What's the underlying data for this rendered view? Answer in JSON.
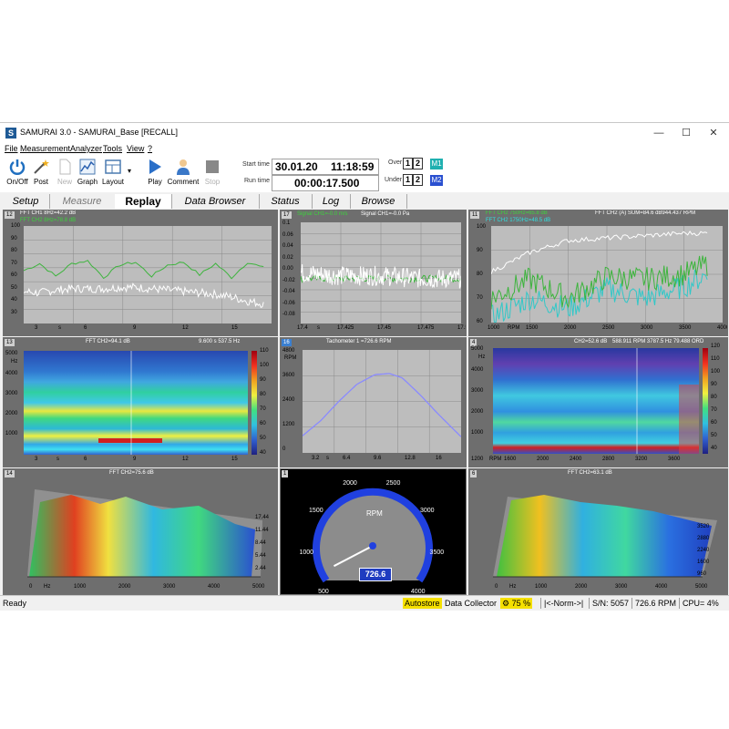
{
  "window": {
    "title": "SAMURAI 3.0 - SAMURAI_Base [RECALL]",
    "logo": "S"
  },
  "menu": [
    "File",
    "Measurement",
    "Analyzer",
    "Tools",
    "View",
    "?"
  ],
  "toolbar": {
    "onoff": "On/Off",
    "post": "Post",
    "new": "New",
    "graph": "Graph",
    "layout": "Layout",
    "play": "Play",
    "comment": "Comment",
    "stop": "Stop",
    "start_time_label": "Start time",
    "start_date": "30.01.20",
    "start_clock": "11:18:59",
    "run_time_label": "Run time",
    "run_time": "00:00:17.500",
    "over_label": "Over",
    "under_label": "Under",
    "one": "1",
    "two": "2",
    "m1": "M1",
    "m2": "M2"
  },
  "tabs": [
    "Setup",
    "Measure",
    "Replay",
    "Data Browser",
    "Status",
    "Log",
    "Browse"
  ],
  "panels": {
    "p12": {
      "num": "12",
      "line1": "FFT CH1 8Hz=42.2 dB",
      "line2": "FFT CH2 8Hz=78.8 dB",
      "y": [
        "100",
        "90",
        "80",
        "70",
        "60",
        "50",
        "40",
        "30"
      ],
      "ylab": "dB\nRMS",
      "x": [
        "3",
        "6",
        "9",
        "12",
        "15"
      ],
      "xunit": "s"
    },
    "p17": {
      "num": "17",
      "line1": "Signal CH1=-0.0 m/s",
      "line2": "Signal CH1=-0.0 Pa",
      "y": [
        "0.1",
        "0.06",
        "0.04",
        "0.02",
        "0.00",
        "-0.02",
        "-0.04",
        "-0.06",
        "-0.08"
      ],
      "yunit": "m/s2",
      "x": [
        "17.4",
        "17.425",
        "17.45",
        "17.475",
        "17.5"
      ],
      "xunit": "s"
    },
    "p11": {
      "num": "11",
      "line1": "FFT CH2 750Hz=65.8 dB",
      "line2": "FFT CH2 1750Hz=48.5 dB",
      "right": "FFT CH2 (A) SUM=84.6 dB944.437 RPM",
      "y": [
        "100",
        "90",
        "80",
        "70",
        "60"
      ],
      "yunit": "dB\nRMS",
      "x": [
        "1000",
        "1500",
        "2000",
        "2500",
        "3000",
        "3500",
        "4000"
      ],
      "xunit": "RPM"
    },
    "p13": {
      "num": "13",
      "title": "FFT CH2=94.1 dB",
      "right": "9.600 s   537.5 Hz",
      "y": [
        "5000",
        "4000",
        "3000",
        "2000",
        "1000"
      ],
      "yunit": "Hz",
      "x": [
        "3",
        "6",
        "9",
        "12",
        "15"
      ],
      "xunit": "s",
      "scale": [
        "110",
        "100",
        "90",
        "80",
        "70",
        "60",
        "50",
        "40"
      ],
      "sunit": "dB\nRMS"
    },
    "p16": {
      "num": "16",
      "title": "Tachometer 1 =726.6 RPM",
      "y": [
        "4800",
        "3600",
        "2400",
        "1200",
        "0"
      ],
      "yunit": "RPM",
      "x": [
        "3.2",
        "6.4",
        "9.6",
        "12.8",
        "16"
      ],
      "xunit": "s"
    },
    "p4": {
      "num": "4",
      "title": "CH2=52.6 dB",
      "right": "588.911 RPM   3787.5 Hz 79.488 ORD",
      "y": [
        "5000",
        "4000",
        "3000",
        "2000",
        "1000"
      ],
      "yunit": "Hz",
      "x": [
        "1200",
        "1600",
        "2000",
        "2400",
        "2800",
        "3200",
        "3600"
      ],
      "xunit": "RPM",
      "scale": [
        "120",
        "110",
        "100",
        "90",
        "80",
        "70",
        "60",
        "50",
        "40"
      ],
      "sunit": "dB"
    },
    "p14": {
      "num": "14",
      "title": "FFT CH2=75.6 dB",
      "x": [
        "0",
        "1000",
        "2000",
        "3000",
        "4000",
        "5000"
      ],
      "xunit": "Hz",
      "z": [
        "17.44",
        "11.44",
        "8.44",
        "5.44",
        "2.44"
      ]
    },
    "p1": {
      "num": "1",
      "unit": "RPM",
      "value": "726.6",
      "ticks": [
        "500",
        "1000",
        "1500",
        "2000",
        "2500",
        "3000",
        "3500",
        "4000"
      ]
    },
    "p6": {
      "num": "6",
      "title": "FFT CH2=63.1 dB",
      "x": [
        "0",
        "1000",
        "2000",
        "3000",
        "4000",
        "5000"
      ],
      "xunit": "Hz",
      "z": [
        "3520",
        "2880",
        "2240",
        "1600",
        "960"
      ]
    }
  },
  "chart_data": [
    {
      "type": "line",
      "title": "FFT CH1 8Hz=42.2 dB",
      "ylabel": "dB RMS",
      "xlabel": "s",
      "ylim": [
        30,
        100
      ],
      "xlim": [
        2,
        17.5
      ],
      "series": [
        {
          "name": "FFT CH1 8Hz=42.2 dB",
          "color": "#ffffff",
          "x": [
            2,
            3,
            4,
            5,
            6,
            7,
            8,
            9,
            10,
            11,
            12,
            13,
            14,
            15,
            16,
            17
          ],
          "values": [
            53,
            52,
            54,
            55,
            55,
            55,
            56,
            56,
            55,
            54,
            53,
            52,
            51,
            49,
            46,
            44
          ]
        },
        {
          "name": "FFT CH2 8Hz=78.8 dB",
          "color": "#3cb43c",
          "x": [
            2,
            3,
            4,
            5,
            6,
            7,
            8,
            9,
            10,
            11,
            12,
            13,
            14,
            15,
            16,
            17
          ],
          "values": [
            68,
            73,
            64,
            73,
            75,
            63,
            72,
            74,
            64,
            72,
            74,
            65,
            73,
            63,
            74,
            70
          ]
        }
      ]
    },
    {
      "type": "line",
      "title": "Signal CH1=-0.0 m/s",
      "ylabel": "m/s2",
      "xlabel": "s",
      "ylim": [
        -0.08,
        0.1
      ],
      "xlim": [
        17.4,
        17.5
      ],
      "series": [
        {
          "name": "Signal CH1=-0.0 m/s",
          "color": "#ffffff",
          "x": [
            17.4,
            17.425,
            17.45,
            17.475,
            17.5
          ],
          "values": [
            0.01,
            0.005,
            0.005,
            0.0,
            0.0
          ]
        },
        {
          "name": "Signal CH1=-0.0 Pa",
          "color": "#3cb43c",
          "x": [
            17.4,
            17.425,
            17.45,
            17.475,
            17.5
          ],
          "values": [
            0.0,
            0.0,
            0.0,
            0.0,
            0.0
          ]
        }
      ]
    },
    {
      "type": "line",
      "title": "FFT CH2 (A) SUM=84.6 dB944.437 RPM",
      "ylabel": "dB RMS",
      "xlabel": "RPM",
      "ylim": [
        60,
        100
      ],
      "xlim": [
        1000,
        4000
      ],
      "series": [
        {
          "name": "FFT CH2 (A) SUM",
          "color": "#ffffff",
          "x": [
            1000,
            1500,
            2000,
            2500,
            3000,
            3500,
            3800
          ],
          "values": [
            81,
            89,
            94,
            95,
            96,
            97,
            97
          ]
        },
        {
          "name": "FFT CH2 750Hz=65.8 dB",
          "color": "#3cb43c",
          "x": [
            1000,
            1500,
            2000,
            2500,
            3000,
            3500,
            3800
          ],
          "values": [
            70,
            78,
            70,
            79,
            78,
            80,
            84
          ]
        },
        {
          "name": "FFT CH2 1750Hz=48.5 dB",
          "color": "#30c8c8",
          "x": [
            1000,
            1500,
            2000,
            2500,
            3000,
            3500,
            3800
          ],
          "values": [
            62,
            70,
            66,
            74,
            70,
            75,
            80
          ]
        }
      ]
    },
    {
      "type": "line",
      "title": "Tachometer 1 =726.6 RPM",
      "ylabel": "RPM",
      "xlabel": "s",
      "ylim": [
        0,
        4800
      ],
      "xlim": [
        0,
        17.5
      ],
      "series": [
        {
          "name": "Tachometer 1",
          "color": "#8a8aff",
          "x": [
            0,
            2,
            4,
            6,
            8,
            9.6,
            11,
            13,
            15,
            17.5
          ],
          "values": [
            800,
            1500,
            2400,
            3200,
            3650,
            3700,
            3500,
            2700,
            1800,
            750
          ]
        }
      ]
    }
  ],
  "status": {
    "ready": "Ready",
    "autostore": "Autostore",
    "collector": "Data Collector",
    "pct": "75 %",
    "norm": "|<-Norm->|",
    "sn": "S/N: 5057",
    "rpm": "726.6 RPM",
    "cpu": "CPU=  4%"
  }
}
